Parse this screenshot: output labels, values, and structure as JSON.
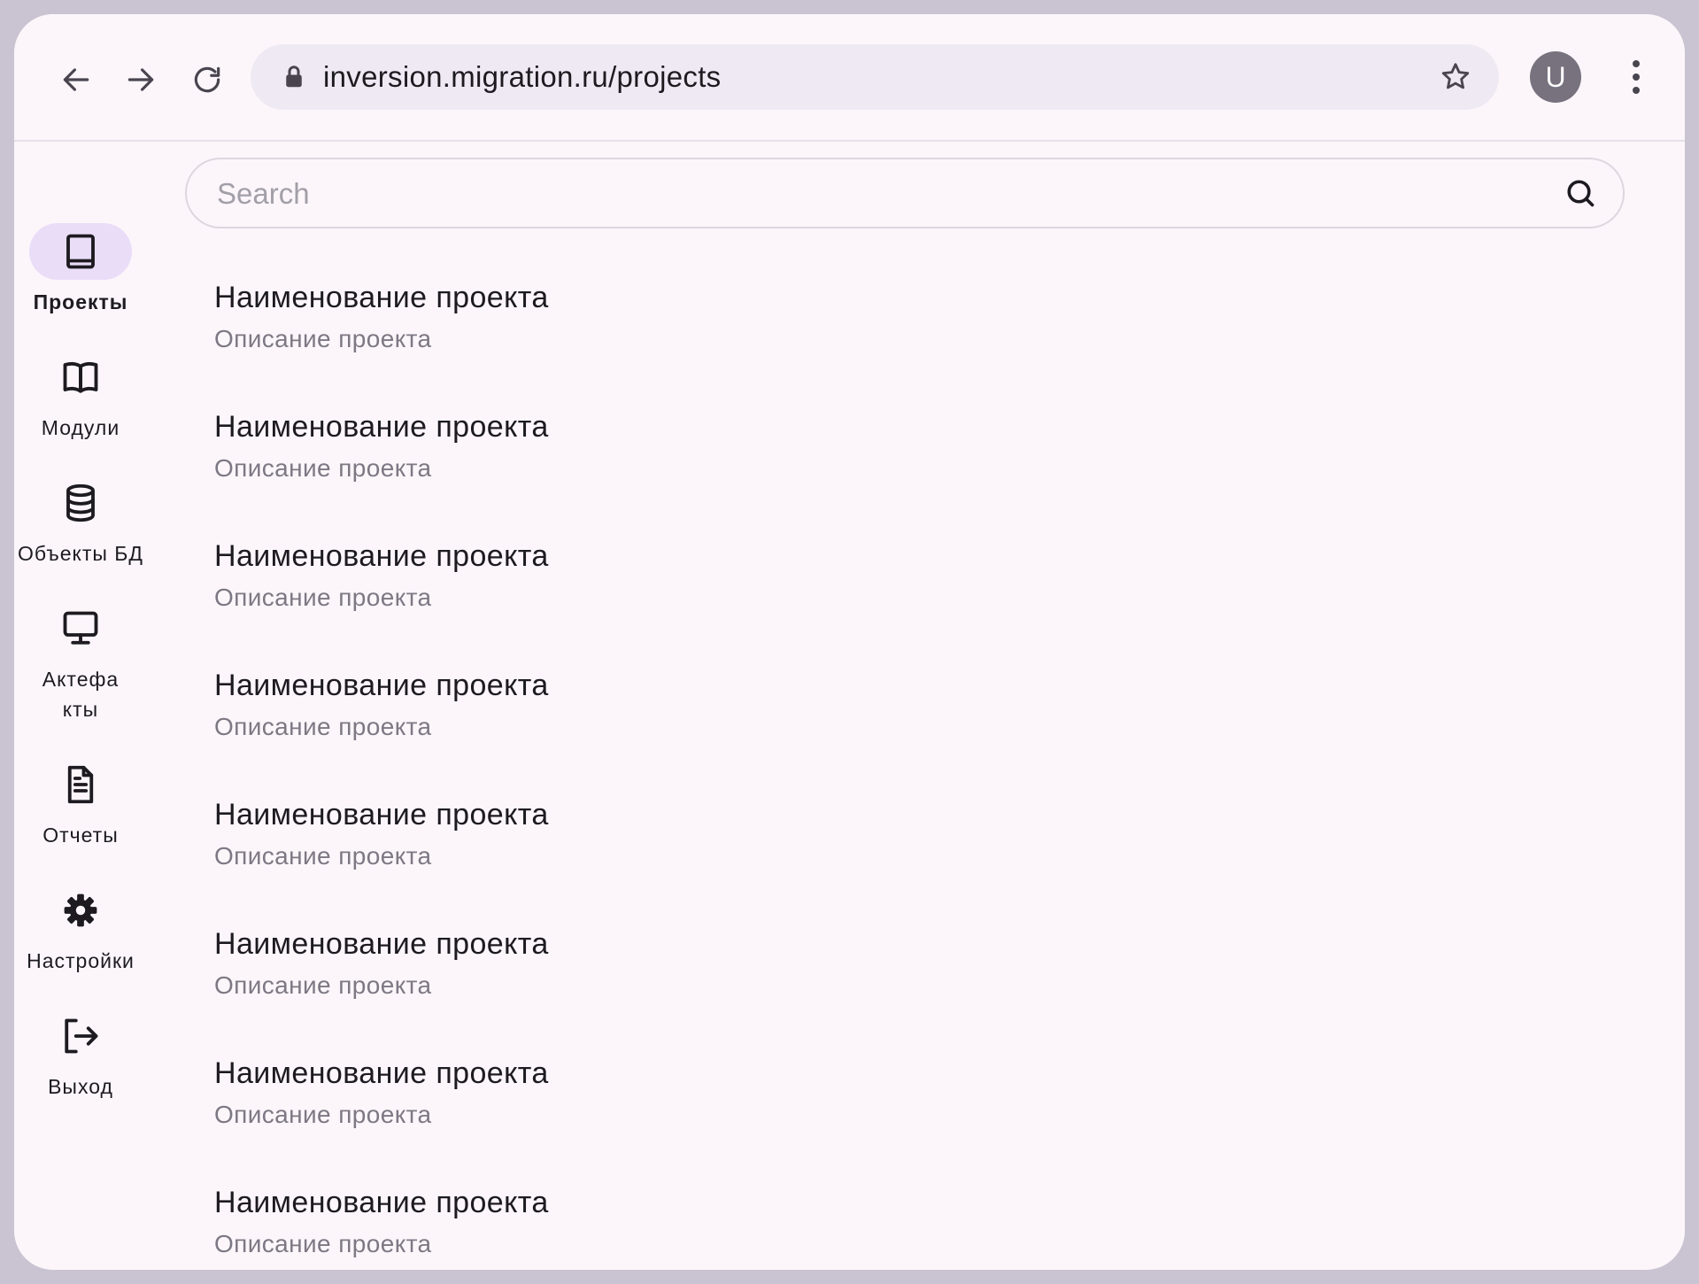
{
  "browser": {
    "url": "inversion.migration.ru/projects",
    "avatar_letter": "U",
    "icons": {
      "back": "arrow-left-icon",
      "forward": "arrow-right-icon",
      "reload": "reload-icon",
      "lock": "lock-icon",
      "bookmark": "star-icon",
      "menu": "more-vertical-icon"
    }
  },
  "nav": {
    "items": [
      {
        "label": "Проекты",
        "icon": "book-icon",
        "active": true
      },
      {
        "label": "Модули",
        "icon": "open-book-icon",
        "active": false
      },
      {
        "label": "Объекты БД",
        "icon": "database-icon",
        "active": false
      },
      {
        "label": "Актефа\nкты",
        "icon": "monitor-icon",
        "active": false
      },
      {
        "label": "Отчеты",
        "icon": "document-icon",
        "active": false
      },
      {
        "label": "Настройки",
        "icon": "gear-icon",
        "active": false
      },
      {
        "label": "Выход",
        "icon": "logout-icon",
        "active": false
      }
    ]
  },
  "search": {
    "placeholder": "Search",
    "value": ""
  },
  "projects": [
    {
      "title": "Наименование проекта",
      "description": "Описание проекта"
    },
    {
      "title": "Наименование проекта",
      "description": "Описание проекта"
    },
    {
      "title": "Наименование проекта",
      "description": "Описание проекта"
    },
    {
      "title": "Наименование проекта",
      "description": "Описание проекта"
    },
    {
      "title": "Наименование проекта",
      "description": "Описание проекта"
    },
    {
      "title": "Наименование проекта",
      "description": "Описание проекта"
    },
    {
      "title": "Наименование проекта",
      "description": "Описание проекта"
    },
    {
      "title": "Наименование проекта",
      "description": "Описание проекта"
    }
  ],
  "colors": {
    "frame": "#cac3d1",
    "surface": "#fcf6fb",
    "active_pill": "#e9ddf8",
    "text": "#1d1b20",
    "secondary_text": "#7d7883"
  }
}
